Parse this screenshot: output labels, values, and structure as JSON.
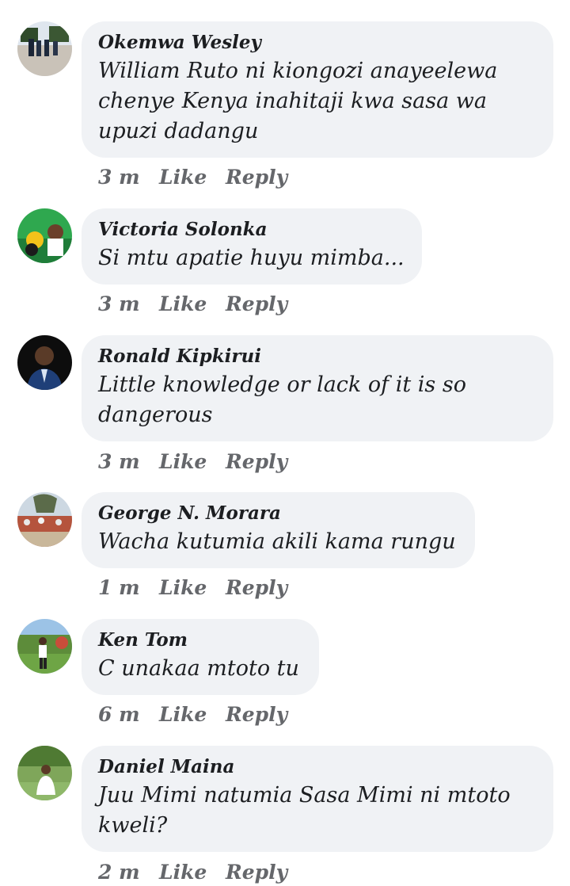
{
  "comments": [
    {
      "author": "Okemwa Wesley",
      "text": "William Ruto ni kiongozi anayeelewa chenye Kenya inahitaji kwa sasa wa upuzi dadangu",
      "time": "3 m",
      "like_label": "Like",
      "reply_label": "Reply"
    },
    {
      "author": "Victoria Solonka",
      "text": "Si mtu apatie huyu mimba...",
      "time": "3 m",
      "like_label": "Like",
      "reply_label": "Reply"
    },
    {
      "author": "Ronald Kipkirui",
      "text": "Little knowledge or lack of it is so dangerous",
      "time": "3 m",
      "like_label": "Like",
      "reply_label": "Reply"
    },
    {
      "author": "George N. Morara",
      "text": "Wacha kutumia akili kama rungu",
      "time": "1 m",
      "like_label": "Like",
      "reply_label": "Reply"
    },
    {
      "author": "Ken Tom",
      "text": "C unakaa mtoto tu",
      "time": "6 m",
      "like_label": "Like",
      "reply_label": "Reply"
    },
    {
      "author": "Daniel Maina",
      "text": "Juu Mimi natumia Sasa Mimi ni mtoto kweli?",
      "time": "2 m",
      "like_label": "Like",
      "reply_label": "Reply"
    }
  ]
}
